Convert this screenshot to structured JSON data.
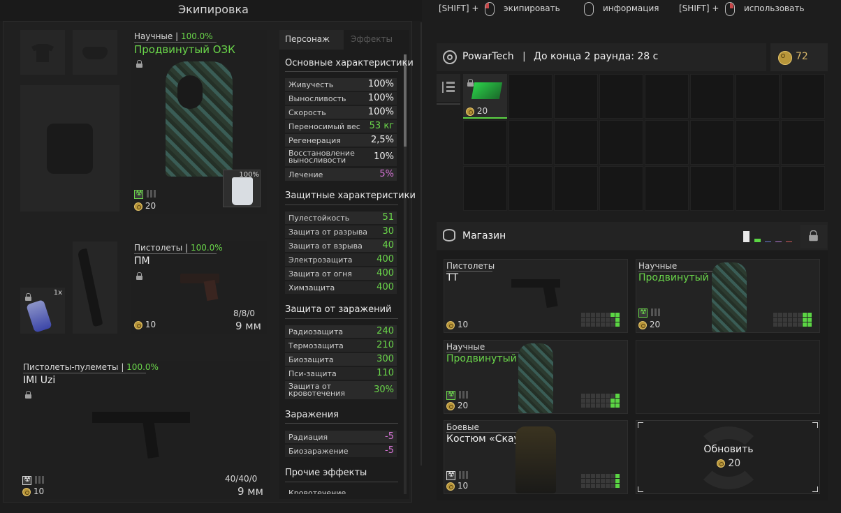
{
  "header": {
    "title": "Экипировка",
    "hint1_mod": "[SHIFT] +",
    "hint1": "экипировать",
    "hint2": "информация",
    "hint3_mod": "[SHIFT] +",
    "hint3": "использовать"
  },
  "armor": {
    "category": "Научные",
    "durability": "100.0%",
    "name": "Продвинутый ОЗК",
    "price": "20",
    "plate_pct": "100%"
  },
  "pistol": {
    "category": "Пистолеты",
    "durability": "100.0%",
    "name": "ПМ",
    "ammo": "8/8/0",
    "caliber": "9 мм",
    "price": "10"
  },
  "grenade": {
    "count": "1x"
  },
  "smg": {
    "category": "Пистолеты-пулеметы",
    "durability": "100.0%",
    "name": "IMI Uzi",
    "ammo": "40/40/0",
    "caliber": "9 мм",
    "price": "10"
  },
  "tabs": {
    "character": "Персонаж",
    "effects": "Эффекты"
  },
  "stats": {
    "basic_title": "Основные характеристики",
    "basic": [
      {
        "label": "Живучесть",
        "value": "100%"
      },
      {
        "label": "Выносливость",
        "value": "100%"
      },
      {
        "label": "Скорость",
        "value": "100%"
      },
      {
        "label": "Переносимый вес",
        "value": "53 кг"
      },
      {
        "label": "Регенерация",
        "value": "2,5%"
      },
      {
        "label": "Восстановление",
        "label2": "выносливости",
        "value": "10%"
      },
      {
        "label": "Лечение",
        "value": "5%"
      }
    ],
    "protect_title": "Защитные характеристики",
    "protect": [
      {
        "label": "Пулестойкость",
        "value": "51"
      },
      {
        "label": "Защита от разрыва",
        "value": "30"
      },
      {
        "label": "Защита от взрыва",
        "value": "40"
      },
      {
        "label": "Электрозащита",
        "value": "400"
      },
      {
        "label": "Защита от огня",
        "value": "400"
      },
      {
        "label": "Химзащита",
        "value": "400"
      }
    ],
    "infect_title": "Защита от заражений",
    "infect": [
      {
        "label": "Радиозащита",
        "value": "240"
      },
      {
        "label": "Термозащита",
        "value": "210"
      },
      {
        "label": "Биозащита",
        "value": "300"
      },
      {
        "label": "Пси-защита",
        "value": "110"
      },
      {
        "label": "Защита от",
        "label2": "кровотечения",
        "value": "30%"
      }
    ],
    "contam_title": "Заражения",
    "contam": [
      {
        "label": "Радиация",
        "value": "-5"
      },
      {
        "label": "Биозаражение",
        "value": "-5"
      }
    ],
    "other_title": "Прочие эффекты",
    "other_cut": "Кровотечение"
  },
  "team": {
    "name": "PowarTech",
    "sep": "|",
    "round": "До конца 2 раунда: 28 с",
    "money": "72"
  },
  "stash": {
    "item_price": "20"
  },
  "shop": {
    "title": "Магазин",
    "items": [
      {
        "category": "Пистолеты",
        "name": "ТТ",
        "price": "10"
      },
      {
        "category": "Научные",
        "name": "Продвинутый ОЗК",
        "price": "20"
      },
      {
        "category": "Научные",
        "name": "Продвинутый ОЗК",
        "price": "20"
      },
      {
        "category": "Боевые",
        "name": "Костюм «Скаут»",
        "price": "10"
      }
    ],
    "refresh": "Обновить",
    "refresh_price": "20"
  },
  "colors": {
    "accent_green": "#6ad64a",
    "pink": "#d472d4",
    "coin": "#b8963a"
  }
}
